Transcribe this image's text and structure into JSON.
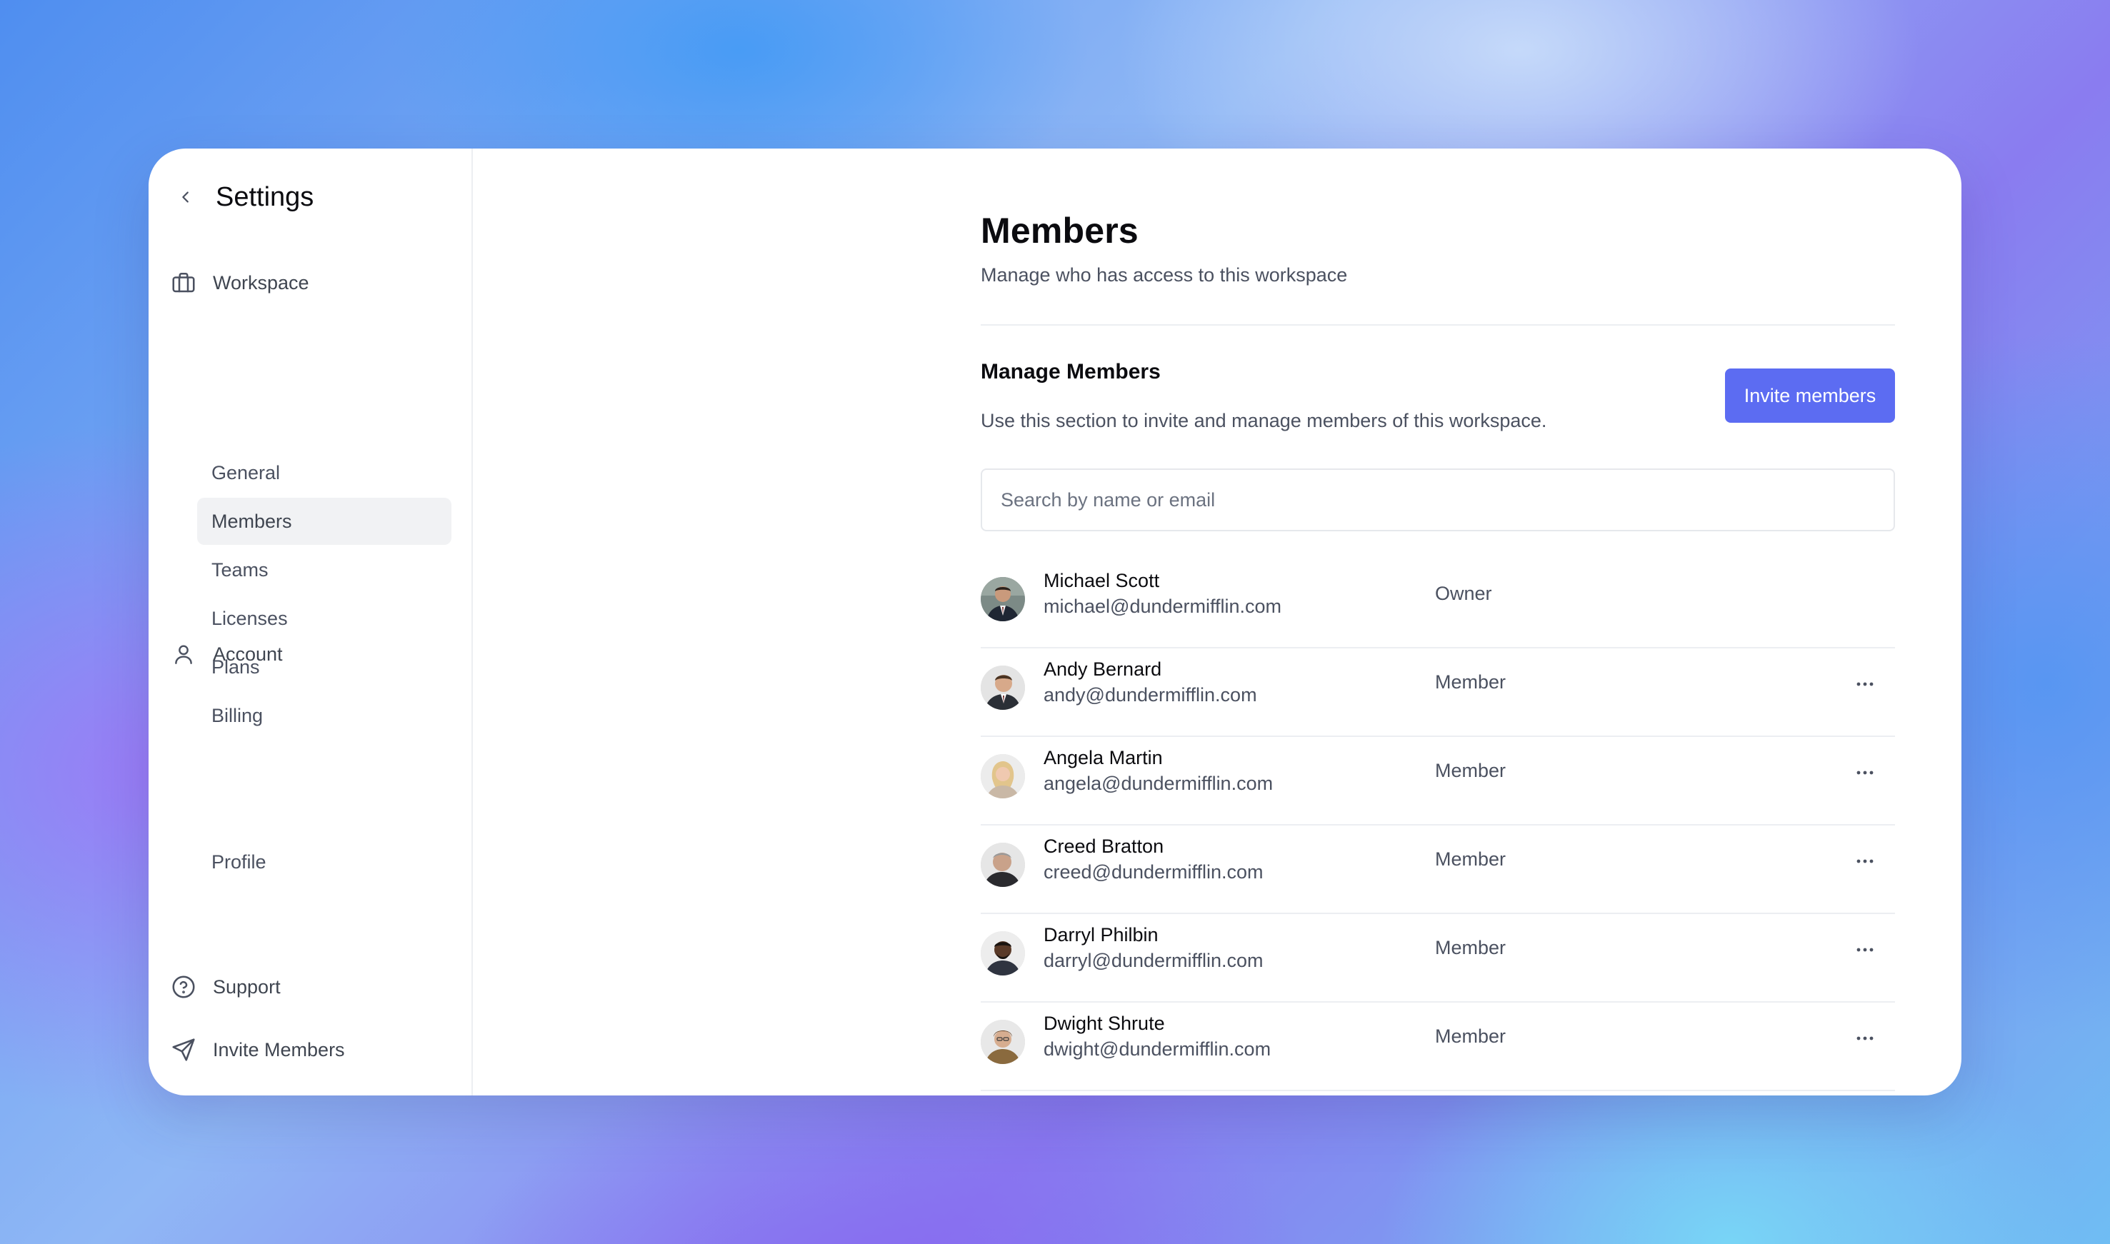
{
  "sidebar": {
    "title": "Settings",
    "workspace": {
      "label": "Workspace",
      "items": [
        {
          "label": "General"
        },
        {
          "label": "Members"
        },
        {
          "label": "Teams"
        },
        {
          "label": "Licenses"
        },
        {
          "label": "Plans"
        },
        {
          "label": "Billing"
        }
      ]
    },
    "account": {
      "label": "Account",
      "items": [
        {
          "label": "Profile"
        }
      ]
    },
    "support_label": "Support",
    "invite_label": "Invite Members",
    "active_item": "Members"
  },
  "main": {
    "title": "Members",
    "subtitle": "Manage who has access to this workspace",
    "section_title": "Manage Members",
    "section_description": "Use this section to invite and manage members of this workspace.",
    "invite_button_label": "Invite members",
    "search_placeholder": "Search by name or email",
    "members": [
      {
        "name": "Michael Scott",
        "email": "michael@dundermifflin.com",
        "role": "Owner"
      },
      {
        "name": "Andy Bernard",
        "email": "andy@dundermifflin.com",
        "role": "Member"
      },
      {
        "name": "Angela Martin",
        "email": "angela@dundermifflin.com",
        "role": "Member"
      },
      {
        "name": "Creed Bratton",
        "email": "creed@dundermifflin.com",
        "role": "Member"
      },
      {
        "name": "Darryl Philbin",
        "email": "darryl@dundermifflin.com",
        "role": "Member"
      },
      {
        "name": "Dwight Shrute",
        "email": "dwight@dundermifflin.com",
        "role": "Member"
      }
    ]
  },
  "colors": {
    "accent": "#5c6cf2",
    "active_item_bg": "#f1f2f4",
    "divider": "#eceef2"
  },
  "icons": {
    "back": "chevron-left-icon",
    "workspace": "briefcase-icon",
    "account": "user-icon",
    "support": "help-circle-icon",
    "invite": "send-icon",
    "row_menu": "more-horizontal-icon"
  }
}
